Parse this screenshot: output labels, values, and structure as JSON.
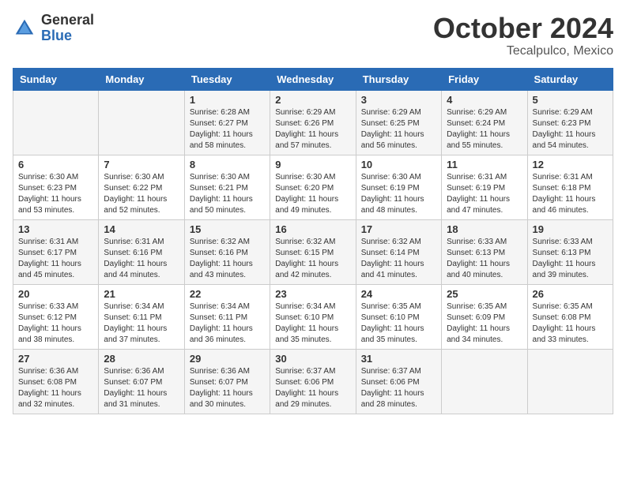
{
  "header": {
    "logo_general": "General",
    "logo_blue": "Blue",
    "month_title": "October 2024",
    "location": "Tecalpulco, Mexico"
  },
  "calendar": {
    "weekdays": [
      "Sunday",
      "Monday",
      "Tuesday",
      "Wednesday",
      "Thursday",
      "Friday",
      "Saturday"
    ],
    "weeks": [
      [
        {
          "day": "",
          "info": ""
        },
        {
          "day": "",
          "info": ""
        },
        {
          "day": "1",
          "info": "Sunrise: 6:28 AM\nSunset: 6:27 PM\nDaylight: 11 hours and 58 minutes."
        },
        {
          "day": "2",
          "info": "Sunrise: 6:29 AM\nSunset: 6:26 PM\nDaylight: 11 hours and 57 minutes."
        },
        {
          "day": "3",
          "info": "Sunrise: 6:29 AM\nSunset: 6:25 PM\nDaylight: 11 hours and 56 minutes."
        },
        {
          "day": "4",
          "info": "Sunrise: 6:29 AM\nSunset: 6:24 PM\nDaylight: 11 hours and 55 minutes."
        },
        {
          "day": "5",
          "info": "Sunrise: 6:29 AM\nSunset: 6:23 PM\nDaylight: 11 hours and 54 minutes."
        }
      ],
      [
        {
          "day": "6",
          "info": "Sunrise: 6:30 AM\nSunset: 6:23 PM\nDaylight: 11 hours and 53 minutes."
        },
        {
          "day": "7",
          "info": "Sunrise: 6:30 AM\nSunset: 6:22 PM\nDaylight: 11 hours and 52 minutes."
        },
        {
          "day": "8",
          "info": "Sunrise: 6:30 AM\nSunset: 6:21 PM\nDaylight: 11 hours and 50 minutes."
        },
        {
          "day": "9",
          "info": "Sunrise: 6:30 AM\nSunset: 6:20 PM\nDaylight: 11 hours and 49 minutes."
        },
        {
          "day": "10",
          "info": "Sunrise: 6:30 AM\nSunset: 6:19 PM\nDaylight: 11 hours and 48 minutes."
        },
        {
          "day": "11",
          "info": "Sunrise: 6:31 AM\nSunset: 6:19 PM\nDaylight: 11 hours and 47 minutes."
        },
        {
          "day": "12",
          "info": "Sunrise: 6:31 AM\nSunset: 6:18 PM\nDaylight: 11 hours and 46 minutes."
        }
      ],
      [
        {
          "day": "13",
          "info": "Sunrise: 6:31 AM\nSunset: 6:17 PM\nDaylight: 11 hours and 45 minutes."
        },
        {
          "day": "14",
          "info": "Sunrise: 6:31 AM\nSunset: 6:16 PM\nDaylight: 11 hours and 44 minutes."
        },
        {
          "day": "15",
          "info": "Sunrise: 6:32 AM\nSunset: 6:16 PM\nDaylight: 11 hours and 43 minutes."
        },
        {
          "day": "16",
          "info": "Sunrise: 6:32 AM\nSunset: 6:15 PM\nDaylight: 11 hours and 42 minutes."
        },
        {
          "day": "17",
          "info": "Sunrise: 6:32 AM\nSunset: 6:14 PM\nDaylight: 11 hours and 41 minutes."
        },
        {
          "day": "18",
          "info": "Sunrise: 6:33 AM\nSunset: 6:13 PM\nDaylight: 11 hours and 40 minutes."
        },
        {
          "day": "19",
          "info": "Sunrise: 6:33 AM\nSunset: 6:13 PM\nDaylight: 11 hours and 39 minutes."
        }
      ],
      [
        {
          "day": "20",
          "info": "Sunrise: 6:33 AM\nSunset: 6:12 PM\nDaylight: 11 hours and 38 minutes."
        },
        {
          "day": "21",
          "info": "Sunrise: 6:34 AM\nSunset: 6:11 PM\nDaylight: 11 hours and 37 minutes."
        },
        {
          "day": "22",
          "info": "Sunrise: 6:34 AM\nSunset: 6:11 PM\nDaylight: 11 hours and 36 minutes."
        },
        {
          "day": "23",
          "info": "Sunrise: 6:34 AM\nSunset: 6:10 PM\nDaylight: 11 hours and 35 minutes."
        },
        {
          "day": "24",
          "info": "Sunrise: 6:35 AM\nSunset: 6:10 PM\nDaylight: 11 hours and 35 minutes."
        },
        {
          "day": "25",
          "info": "Sunrise: 6:35 AM\nSunset: 6:09 PM\nDaylight: 11 hours and 34 minutes."
        },
        {
          "day": "26",
          "info": "Sunrise: 6:35 AM\nSunset: 6:08 PM\nDaylight: 11 hours and 33 minutes."
        }
      ],
      [
        {
          "day": "27",
          "info": "Sunrise: 6:36 AM\nSunset: 6:08 PM\nDaylight: 11 hours and 32 minutes."
        },
        {
          "day": "28",
          "info": "Sunrise: 6:36 AM\nSunset: 6:07 PM\nDaylight: 11 hours and 31 minutes."
        },
        {
          "day": "29",
          "info": "Sunrise: 6:36 AM\nSunset: 6:07 PM\nDaylight: 11 hours and 30 minutes."
        },
        {
          "day": "30",
          "info": "Sunrise: 6:37 AM\nSunset: 6:06 PM\nDaylight: 11 hours and 29 minutes."
        },
        {
          "day": "31",
          "info": "Sunrise: 6:37 AM\nSunset: 6:06 PM\nDaylight: 11 hours and 28 minutes."
        },
        {
          "day": "",
          "info": ""
        },
        {
          "day": "",
          "info": ""
        }
      ]
    ]
  }
}
